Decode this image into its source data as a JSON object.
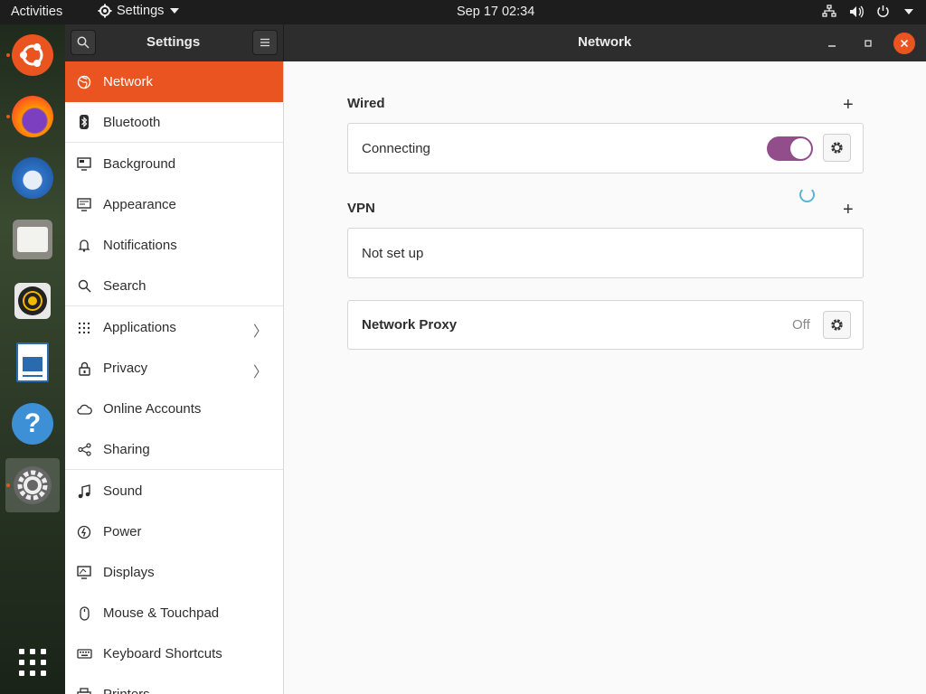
{
  "topbar": {
    "activities": "Activities",
    "app_menu": "Settings",
    "clock": "Sep 17  02:34",
    "tray_icons": [
      "network-icon",
      "volume-icon",
      "power-icon"
    ]
  },
  "dock": {
    "apps": [
      "ubuntu-software-icon",
      "firefox-icon",
      "thunderbird-icon",
      "files-icon",
      "rhythmbox-icon",
      "libreoffice-writer-icon",
      "help-icon",
      "settings-icon"
    ],
    "show_apps_icon": "grid-icon"
  },
  "window": {
    "sidebar_title": "Settings",
    "title": "Network"
  },
  "sidebar": {
    "items": [
      {
        "label": "Network",
        "icon": "network-icon",
        "selected": true
      },
      {
        "label": "Bluetooth",
        "icon": "bluetooth-icon"
      },
      {
        "label": "Background",
        "icon": "monitor-icon"
      },
      {
        "label": "Appearance",
        "icon": "appearance-icon"
      },
      {
        "label": "Notifications",
        "icon": "bell-icon"
      },
      {
        "label": "Search",
        "icon": "search-icon"
      },
      {
        "label": "Applications",
        "icon": "grid-icon"
      },
      {
        "label": "Privacy",
        "icon": "lock-icon"
      },
      {
        "label": "Online Accounts",
        "icon": "cloud-icon"
      },
      {
        "label": "Sharing",
        "icon": "share-icon"
      },
      {
        "label": "Sound",
        "icon": "music-note-icon"
      },
      {
        "label": "Power",
        "icon": "power-icon"
      },
      {
        "label": "Displays",
        "icon": "display-icon"
      },
      {
        "label": "Mouse & Touchpad",
        "icon": "mouse-icon"
      },
      {
        "label": "Keyboard Shortcuts",
        "icon": "keyboard-icon"
      },
      {
        "label": "Printers",
        "icon": "printer-icon"
      }
    ]
  },
  "network": {
    "wired": {
      "title": "Wired",
      "status": "Connecting",
      "enabled": true
    },
    "vpn": {
      "title": "VPN",
      "status": "Not set up"
    },
    "proxy": {
      "label": "Network Proxy",
      "value": "Off"
    }
  },
  "colors": {
    "accent": "#e95420",
    "toggle_on": "#924d8b"
  }
}
